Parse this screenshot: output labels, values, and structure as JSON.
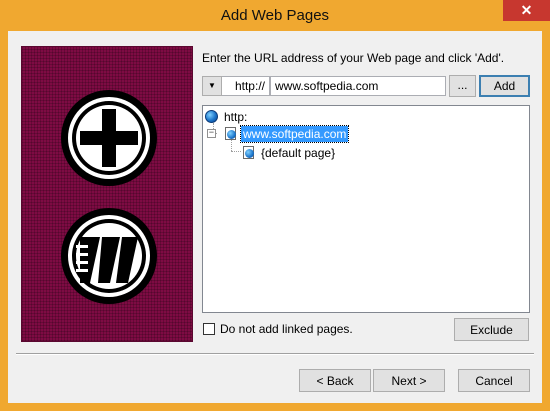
{
  "window": {
    "title": "Add Web Pages",
    "close_glyph": "✕"
  },
  "instructions": "Enter the URL address of your Web page and click 'Add'.",
  "url_bar": {
    "protocol_dropdown_glyph": "▼",
    "protocol": "http://",
    "url_value": "www.softpedia.com",
    "browse_label": "...",
    "add_label": "Add"
  },
  "tree": {
    "root": {
      "label": "http:",
      "icon": "globe-icon"
    },
    "site": {
      "label": "www.softpedia.com",
      "icon": "web-page-icon",
      "expander": "−",
      "selected": true
    },
    "page": {
      "label": "{default page}",
      "icon": "web-page-icon"
    }
  },
  "options": {
    "no_linked_pages_label": "Do not add linked pages.",
    "no_linked_pages_checked": false
  },
  "exclude_label": "Exclude",
  "footer": {
    "back_label": "< Back",
    "next_label": "Next >",
    "cancel_label": "Cancel"
  },
  "side_panel": {
    "icons": [
      "add-icon",
      "web-pages-icon"
    ]
  },
  "colors": {
    "titlebar": "#f0a830",
    "close": "#c7372f",
    "side_panel": "#7e0b43",
    "selection": "#3399ff"
  }
}
